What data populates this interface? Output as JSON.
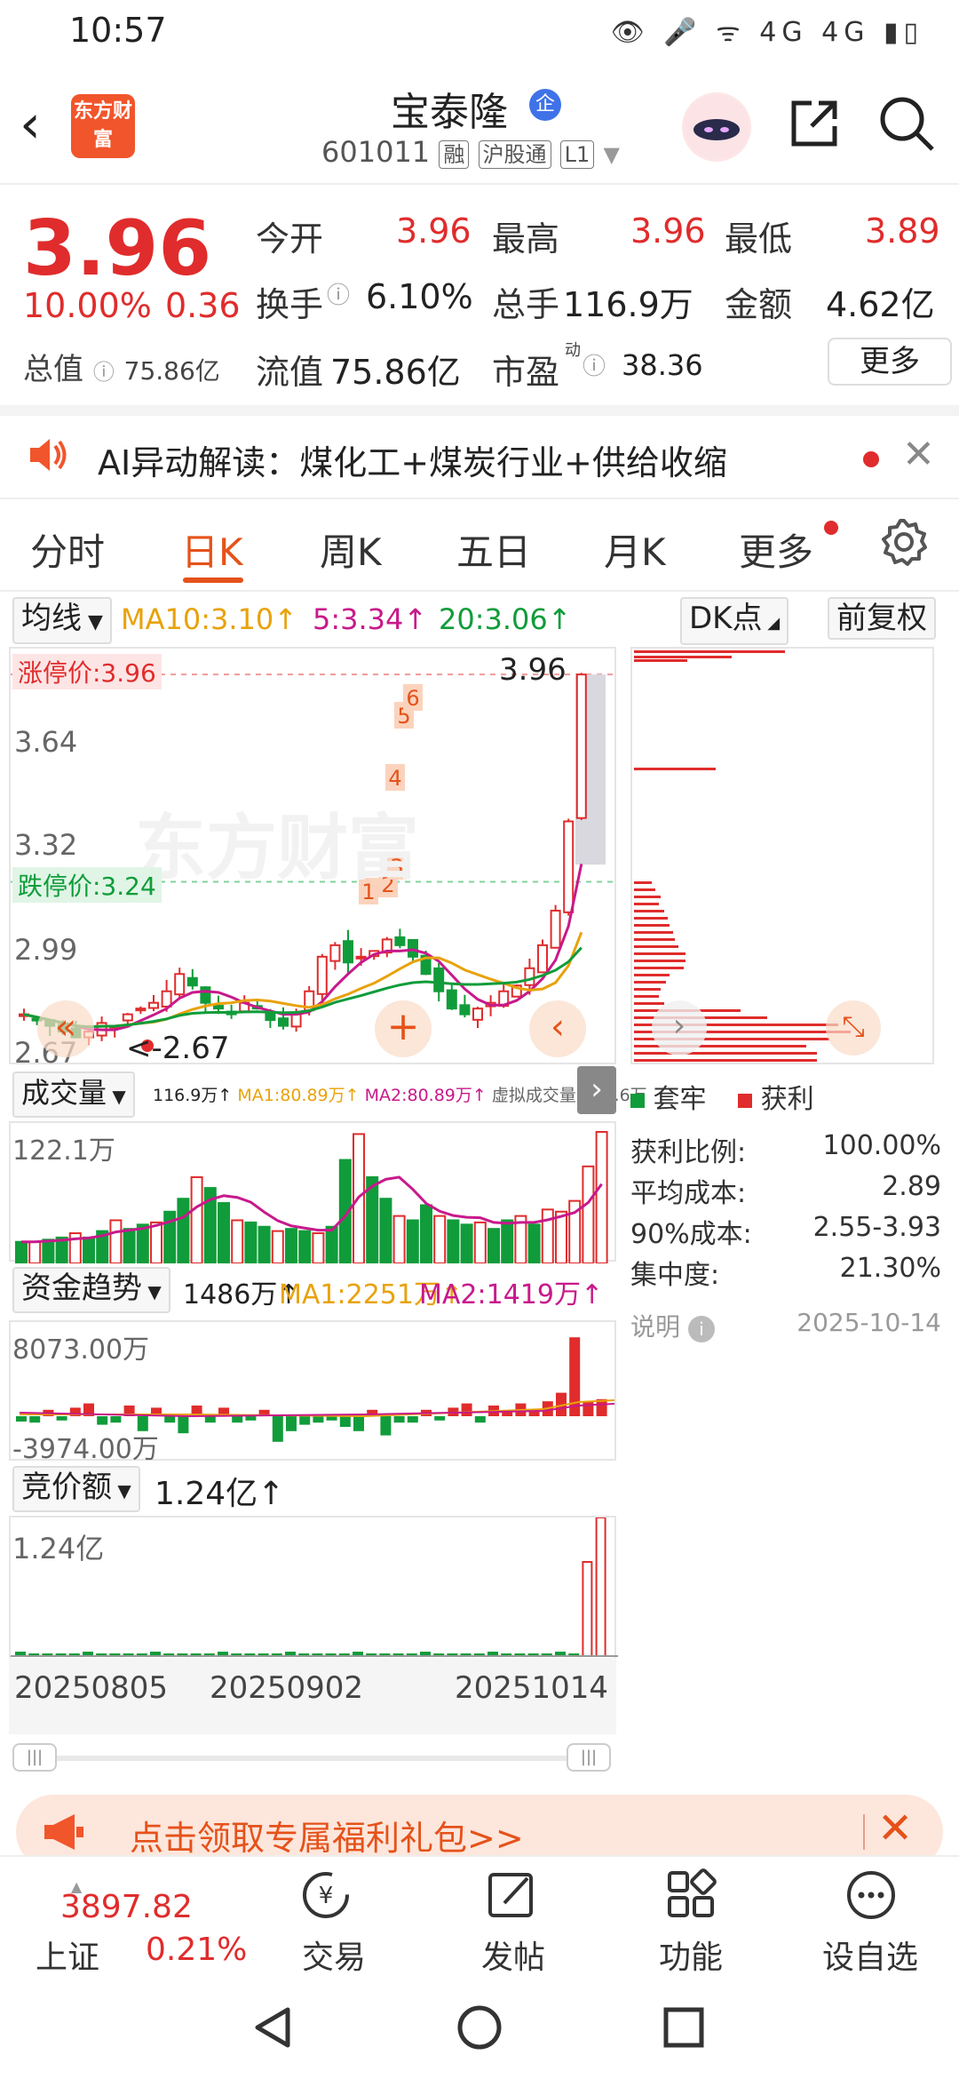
{
  "status": {
    "time": "10:57",
    "icons": "👁 🎤 ᯤ 4G 4G ▮▯"
  },
  "header": {
    "logo": "东方财富",
    "name": "宝泰隆",
    "badge": "企",
    "code": "601011",
    "tags": [
      "融",
      "沪股通",
      "L1"
    ]
  },
  "quote": {
    "price": "3.96",
    "change_pct": "10.00%",
    "change_val": "0.36",
    "open_label": "今开",
    "open": "3.96",
    "high_label": "最高",
    "high": "3.96",
    "low_label": "最低",
    "low": "3.89",
    "turnover_label": "换手",
    "turnover": "6.10%",
    "volume_label": "总手",
    "volume": "116.9万",
    "amount_label": "金额",
    "amount": "4.62亿",
    "mktcap_label": "总值",
    "mktcap": "75.86亿",
    "float_label": "流值",
    "float": "75.86亿",
    "pe_label": "市盈",
    "pe_sup": "动",
    "pe": "38.36",
    "more": "更多"
  },
  "ai": {
    "text": "AI异动解读：煤化工+煤炭行业+供给收缩"
  },
  "tabs": [
    "分时",
    "日K",
    "周K",
    "五日",
    "月K",
    "更多"
  ],
  "indicator": {
    "select": "均线",
    "ma10": "MA10:3.10↑",
    "ma5": "5:3.34↑",
    "ma20": "20:3.06↑",
    "dk": "DK点",
    "adj": "前复权"
  },
  "kline": {
    "limit_up": "涨停价:3.96",
    "limit_down": "跌停价:3.24",
    "y_labels": [
      "3.64",
      "3.32",
      "2.99",
      "2.67"
    ],
    "current_marker": "3.96",
    "low_marker": "2.67",
    "watermark": "东方财富",
    "point_tags": [
      "1",
      "2",
      "3",
      "4",
      "5",
      "6"
    ]
  },
  "volume": {
    "select": "成交量",
    "summary": [
      "116.9万↑",
      "MA1:80.89万↑",
      "MA2:80.89万↑",
      "虚拟成交量:118.6万"
    ],
    "max_label": "122.1万"
  },
  "capital": {
    "select": "资金趋势",
    "value": "1486万↑",
    "ma1": "MA1:2251万↑",
    "ma2": "MA2:1419万↑",
    "max_label": "8073.00万",
    "min_label": "-3974.00万"
  },
  "auction": {
    "select": "竞价额",
    "value": "1.24亿↑",
    "max_label": "1.24亿"
  },
  "dates": [
    "20250805",
    "20250902",
    "20251014"
  ],
  "side": {
    "legend_trap": "套牢",
    "legend_profit": "获利",
    "rows": [
      {
        "label": "获利比例:",
        "value": "100.00%"
      },
      {
        "label": "平均成本:",
        "value": "2.89"
      },
      {
        "label": "90%成本:",
        "value": "2.55-3.93"
      },
      {
        "label": "集中度:",
        "value": "21.30%"
      }
    ],
    "note": "说明",
    "date": "2025-10-14"
  },
  "promo": {
    "text": "点击领取专属福利礼包>>"
  },
  "bottom": {
    "index_value": "3897.82",
    "index_name": "上证",
    "index_change": "0.21%",
    "items": [
      "交易",
      "发帖",
      "功能",
      "设自选"
    ]
  },
  "colors": {
    "up": "#e02c2c",
    "down": "#109c3a",
    "accent": "#e5521a"
  }
}
